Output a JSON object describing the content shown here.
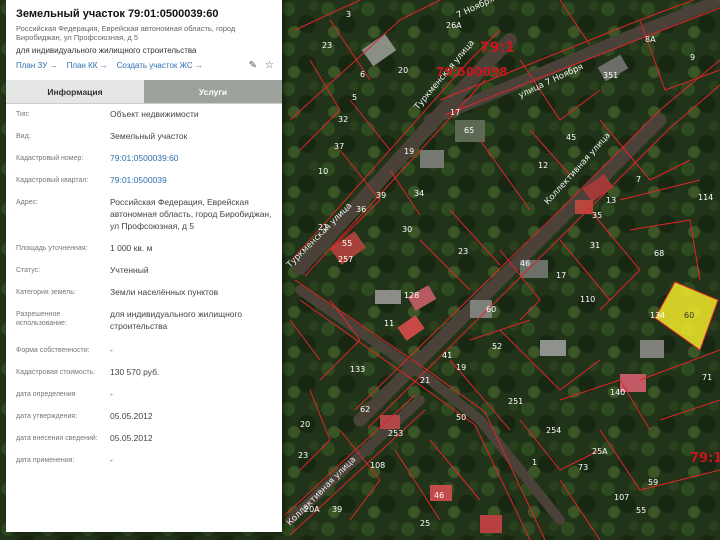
{
  "panel": {
    "title": "Земельный участок 79:01:0500039:60",
    "address_subtitle": "Российская Федерация, Еврейская автономная область, город Биробиджан, ул Профсоюзная, д 5",
    "purpose": "для индивидуального жилищного строительства",
    "links": [
      "План ЗУ →",
      "План КК →",
      "Создать участок ЖС →"
    ],
    "tabs": {
      "info": "Информация",
      "services": "Услуги"
    },
    "rows": [
      {
        "key": "Тип:",
        "value": "Объект недвижимости"
      },
      {
        "key": "Вид:",
        "value": "Земельный участок"
      },
      {
        "key": "Кадастровый номер:",
        "value": "79:01:0500039:60"
      },
      {
        "key": "Кадастровый квартал:",
        "value": "79:01:0500039"
      },
      {
        "key": "Адрес:",
        "value": "Российская Федерация, Еврейская автономная область, город Биробиджан, ул Профсоюзная, д 5"
      },
      {
        "key": "Площадь уточненная:",
        "value": "1 000 кв. м"
      },
      {
        "key": "Статус:",
        "value": "Учтенный"
      },
      {
        "key": "Категория земель:",
        "value": "Земли населённых пунктов"
      },
      {
        "key": "Разрешенное использование:",
        "value": "для индивидуального жилищного строительства"
      },
      {
        "key": "Форма собственности:",
        "value": "-"
      },
      {
        "key": "Кадастровая стоимость:",
        "value": "130 570 руб."
      },
      {
        "key": "дата определения",
        "value": "-"
      },
      {
        "key": "дата утверждения:",
        "value": "05.05.2012"
      },
      {
        "key": "дата внесения сведений:",
        "value": "05.05.2012"
      },
      {
        "key": "дата применения:",
        "value": "-"
      }
    ]
  },
  "map": {
    "block_labels": [
      "79:1",
      "79:500098",
      "79:1"
    ],
    "streets": [
      "Туркменская улица",
      "улица 7 Ноября",
      "Коллективная улица",
      "Туркменская улица",
      "Коллективная улица",
      "7 Ноября"
    ],
    "parcel_numbers": [
      "3",
      "26А",
      "8А",
      "23",
      "20",
      "6",
      "351",
      "9",
      "5",
      "17",
      "65",
      "19",
      "12",
      "45",
      "37",
      "32",
      "7",
      "114",
      "10",
      "34",
      "39",
      "30",
      "36",
      "21",
      "31",
      "35",
      "13",
      "55",
      "257",
      "23",
      "46",
      "68",
      "17",
      "110",
      "134",
      "128",
      "11",
      "60",
      "52",
      "133",
      "41",
      "19",
      "251",
      "71",
      "62",
      "21",
      "140",
      "254",
      "253",
      "50",
      "23",
      "108",
      "73",
      "59",
      "25А",
      "20",
      "46",
      "20А",
      "25",
      "55",
      "107",
      "39",
      "1",
      "16",
      "63",
      "27",
      "53",
      "44"
    ],
    "selected_parcel": "60",
    "colors": {
      "boundary": "#e0242a",
      "block_label": "#c7161d",
      "selected_fill": "#f2ea2a",
      "label": "#ffffff"
    }
  }
}
